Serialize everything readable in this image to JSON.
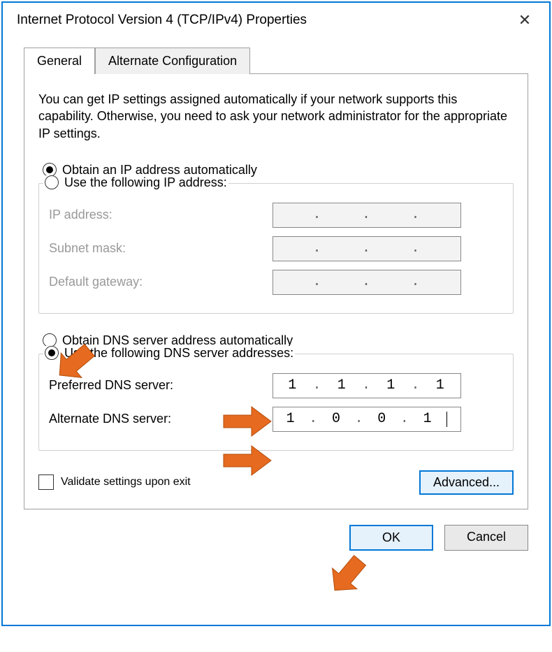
{
  "window": {
    "title": "Internet Protocol Version 4 (TCP/IPv4) Properties"
  },
  "tabs": {
    "general": "General",
    "alternate": "Alternate Configuration"
  },
  "description": "You can get IP settings assigned automatically if your network supports this capability. Otherwise, you need to ask your network administrator for the appropriate IP settings.",
  "ip": {
    "radio_auto": "Obtain an IP address automatically",
    "radio_manual": "Use the following IP address:",
    "label_ip": "IP address:",
    "label_mask": "Subnet mask:",
    "label_gateway": "Default gateway:",
    "value_ip": "",
    "value_mask": "",
    "value_gateway": ""
  },
  "dns": {
    "radio_auto": "Obtain DNS server address automatically",
    "radio_manual": "Use the following DNS server addresses:",
    "label_preferred": "Preferred DNS server:",
    "label_alternate": "Alternate DNS server:",
    "preferred": {
      "o1": "1",
      "o2": "1",
      "o3": "1",
      "o4": "1"
    },
    "alternate": {
      "o1": "1",
      "o2": "0",
      "o3": "0",
      "o4": "1"
    }
  },
  "validate_label": "Validate settings upon exit",
  "advanced_label": "Advanced...",
  "buttons": {
    "ok": "OK",
    "cancel": "Cancel"
  }
}
